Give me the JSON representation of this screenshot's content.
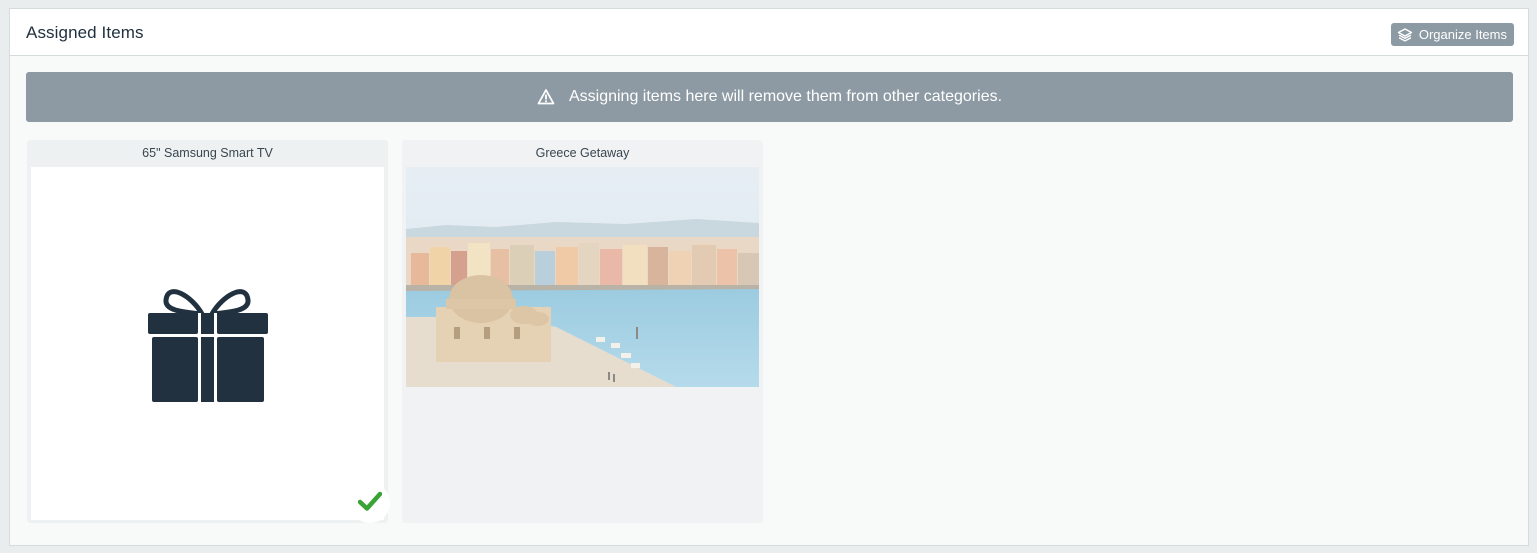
{
  "panel": {
    "title": "Assigned Items",
    "organize_button": {
      "label": "Organize Items",
      "icon": "layers-icon"
    }
  },
  "alert": {
    "icon": "warning-icon",
    "message": "Assigning items here will remove them from other categories."
  },
  "items": [
    {
      "title": "65\" Samsung Smart TV",
      "image": "gift-icon",
      "selected": true,
      "badge_icon": "checkmark-icon"
    },
    {
      "title": "Greece Getaway",
      "image": "harbor-photo",
      "selected": false
    }
  ],
  "colors": {
    "header_text": "#22313f",
    "alert_background": "#8d9aa3",
    "button_background": "#8c9aa3",
    "gift": "#22313f",
    "check": "#3aa336"
  }
}
